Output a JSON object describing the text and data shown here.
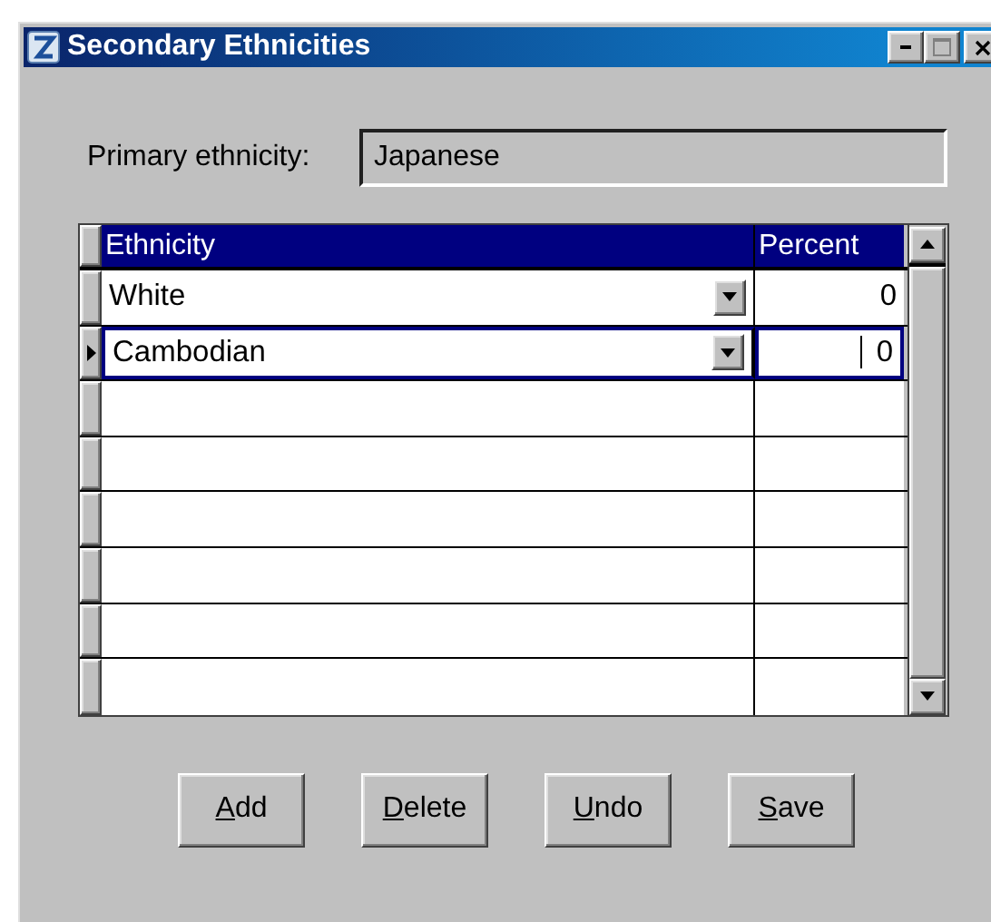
{
  "window": {
    "title": "Secondary Ethnicities"
  },
  "primary_ethnicity": {
    "label": "Primary ethnicity:",
    "value": "Japanese"
  },
  "table": {
    "columns": [
      "Ethnicity",
      "Percent"
    ],
    "rows": [
      {
        "kind": "entry",
        "ethnicity": "White",
        "percent": "0",
        "selected": false
      },
      {
        "kind": "entry",
        "ethnicity": "Cambodian",
        "percent": "0",
        "selected": true
      },
      {
        "kind": "blank",
        "selected": false
      },
      {
        "kind": "blank",
        "selected": false
      },
      {
        "kind": "blank",
        "selected": false
      },
      {
        "kind": "blank",
        "selected": false
      },
      {
        "kind": "blank",
        "selected": false
      },
      {
        "kind": "blank",
        "selected": false
      }
    ]
  },
  "buttons": [
    {
      "label": "Add"
    },
    {
      "label": "Delete"
    },
    {
      "label": "Undo"
    },
    {
      "label": "Save"
    }
  ]
}
